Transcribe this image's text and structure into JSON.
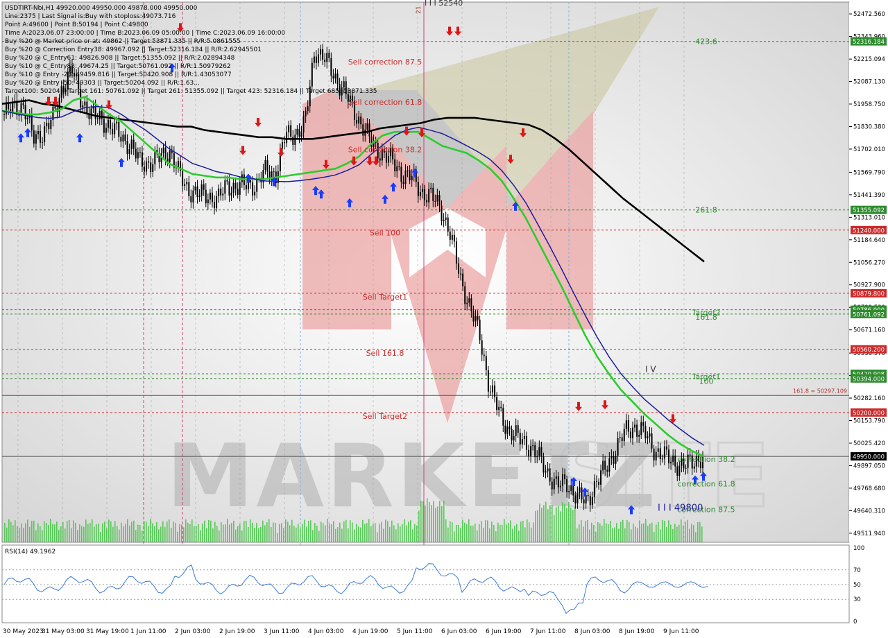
{
  "header": {
    "lines": [
      "USDTIRT-Nbi,H1  49920.000 49950.000 49878.000 49950.000",
      "Line:2375 | Last Signal is:Buy with stoploss:49073.716",
      "Point A:49600 | Point B:50194 | Point C:49800",
      "Time A:2023.06.07 23:00:00 | Time B:2023.06.09 05:00:00 | Time C:2023.06.09 16:00:00",
      "Buy %20 @ Market price or at: 49862 || Target:53871.335 || R/R:5.0861555",
      "Buy %20 @ Correction Entry38: 49967.092 || Target:52316.184 || R/R:2.62945501",
      "Buy %20 @ C_Entry61: 49826.908 || Target:51355.092 || R/R:2.02894348",
      "Buy %10 @ C_Entry88: 49674.25 || Target:50761.092 || R/R:1.50979262",
      "Buy %10 @ Entry -23: 49459.816 || Target:50420.908 || R/R:1.43053077",
      "Buy %20 @ Entry -50: 49303 || Target:50204.092 || R/R:1.63...",
      "Target100: 50204 || Target 161: 50761.092 || Target 261: 51355.092 || Target 423: 52316.184 || Target 685: 53871.335"
    ]
  },
  "price_axis": {
    "ticks": [
      "52472.560",
      "52343.960",
      "52215.094",
      "52087.130",
      "51958.750",
      "51830.380",
      "51702.010",
      "51569.790",
      "51441.390",
      "51313.010",
      "51184.640",
      "51056.270",
      "50927.900",
      "50799.530",
      "50671.160",
      "50538.970",
      "50410.390",
      "50282.160",
      "50153.790",
      "50025.420",
      "49897.050",
      "49768.680",
      "49640.310",
      "49511.940"
    ]
  },
  "price_tags": [
    {
      "text": "52316.184",
      "price": 52316.184,
      "bg": "#2e8b2e"
    },
    {
      "text": "51355.092",
      "price": 51355.092,
      "bg": "#2e8b2e"
    },
    {
      "text": "51240.000",
      "price": 51240.0,
      "bg": "#cc2a2a"
    },
    {
      "text": "50879.800",
      "price": 50879.8,
      "bg": "#cc2a2a"
    },
    {
      "text": "50786.000",
      "price": 50786.0,
      "bg": "#2e8b2e"
    },
    {
      "text": "50761.092",
      "price": 50761.092,
      "bg": "#2e8b2e"
    },
    {
      "text": "50560.200",
      "price": 50560.2,
      "bg": "#cc2a2a"
    },
    {
      "text": "50420.908",
      "price": 50420.908,
      "bg": "#2e8b2e"
    },
    {
      "text": "50394.000",
      "price": 50394.0,
      "bg": "#2e8b2e"
    },
    {
      "text": "50200.000",
      "price": 50200.0,
      "bg": "#cc2a2a"
    },
    {
      "text": "49950.000",
      "price": 49950.0,
      "bg": "#000000"
    }
  ],
  "level_lines": [
    {
      "price": 52316.184,
      "color": "#2e8b2e"
    },
    {
      "price": 51355.092,
      "color": "#2e8b2e"
    },
    {
      "price": 51240.0,
      "color": "#cc2a2a"
    },
    {
      "price": 50879.8,
      "color": "#cc2a2a"
    },
    {
      "price": 50786.0,
      "color": "#2e8b2e"
    },
    {
      "price": 50761.092,
      "color": "#2e8b2e"
    },
    {
      "price": 50560.2,
      "color": "#cc2a2a"
    },
    {
      "price": 50420.908,
      "color": "#2e8b2e"
    },
    {
      "price": 50394.0,
      "color": "#2e8b2e"
    },
    {
      "price": 50200.0,
      "color": "#cc2a2a"
    }
  ],
  "level_labels": [
    {
      "text": "423.6",
      "price": 52316.184,
      "color": "#2e8b2e",
      "at": "right"
    },
    {
      "text": "261.8",
      "price": 51355.092,
      "color": "#2e8b2e",
      "at": "right"
    },
    {
      "text": "Sell correction 87.5",
      "price": 52200,
      "color": "#cc2a2a",
      "at": "left"
    },
    {
      "text": "Sell correction 61.8",
      "price": 51970,
      "color": "#cc2a2a",
      "at": "left"
    },
    {
      "text": "Sell correction 38.2",
      "price": 51700,
      "color": "#cc2a2a",
      "at": "left"
    },
    {
      "text": "Sell 100",
      "price": 51225,
      "color": "#cc2a2a",
      "at": "left"
    },
    {
      "text": "Sell Target1",
      "price": 50860,
      "color": "#cc2a2a",
      "at": "left"
    },
    {
      "text": "Sell 161.8",
      "price": 50540,
      "color": "#cc2a2a",
      "at": "left"
    },
    {
      "text": "Sell Target2",
      "price": 50180,
      "color": "#cc2a2a",
      "at": "left"
    },
    {
      "text": "Target2",
      "price": 50770,
      "color": "#2e8b2e",
      "at": "right"
    },
    {
      "text": "161.8",
      "price": 50745,
      "color": "#2e8b2e",
      "at": "right"
    },
    {
      "text": "Target1",
      "price": 50405,
      "color": "#2e8b2e",
      "at": "right"
    },
    {
      "text": "100",
      "price": 50380,
      "color": "#2e8b2e",
      "at": "right"
    },
    {
      "text": "correction 38.2",
      "price": 49935,
      "color": "#2e8b2e",
      "at": "right"
    },
    {
      "text": "correction 61.8",
      "price": 49795,
      "color": "#2e8b2e",
      "at": "right"
    },
    {
      "text": "correction 87.5",
      "price": 49647,
      "color": "#2e8b2e",
      "at": "right"
    }
  ],
  "other_labels": {
    "fib_line": "161.8 = 50297.109",
    "wave_iv": "I V",
    "wave_iii": "I I I 49800",
    "top_mark": "I I I 52540",
    "vline_21": "21"
  },
  "rsi": {
    "label": "RSI(14) 49.1962",
    "ticks": [
      "100",
      "70",
      "50",
      "30",
      "0"
    ]
  },
  "time_axis": {
    "labels": [
      "30 May 2023",
      "31 May 03:00",
      "31 May 19:00",
      "1 Jun 11:00",
      "2 Jun 03:00",
      "2 Jun 19:00",
      "3 Jun 11:00",
      "4 Jun 03:00",
      "4 Jun 19:00",
      "5 Jun 11:00",
      "6 Jun 03:00",
      "6 Jun 19:00",
      "7 Jun 11:00",
      "8 Jun 03:00",
      "8 Jun 19:00",
      "9 Jun 11:00"
    ]
  },
  "watermark": "MARKETZ",
  "chart_data": {
    "type": "line",
    "title": "USDTIRT-Nbi,H1",
    "x": [
      "30 May 2023",
      "31 May 03:00",
      "31 May 19:00",
      "1 Jun 11:00",
      "2 Jun 03:00",
      "2 Jun 19:00",
      "3 Jun 11:00",
      "4 Jun 03:00",
      "4 Jun 19:00",
      "5 Jun 11:00",
      "6 Jun 03:00",
      "6 Jun 19:00",
      "7 Jun 11:00",
      "8 Jun 03:00",
      "8 Jun 19:00",
      "9 Jun 11:00"
    ],
    "ylim": [
      49460,
      52540
    ],
    "series": [
      {
        "values": [
          51900,
          51940,
          51950,
          51760,
          51800,
          51870,
          52060,
          52150,
          51980,
          51890,
          51880,
          51820,
          51780,
          51720,
          51630,
          51620,
          51650,
          51700,
          51560,
          51470,
          51440,
          51440,
          51410,
          51500,
          51480,
          51500,
          51500,
          51580,
          51560,
          51780,
          51790,
          51840,
          52270,
          52220,
          52120,
          52040,
          51920,
          51830,
          51720,
          51680,
          51630,
          51560,
          51540,
          51460,
          51430,
          51370,
          51210,
          50970,
          50800,
          50640,
          50350,
          50200,
          50100,
          50050,
          50020,
          49950,
          49860,
          49780,
          49800,
          49720,
          49690,
          49800,
          49880,
          49990,
          50090,
          50120,
          50080,
          49990,
          49950,
          49920,
          49890,
          49920,
          49950
        ]
      },
      {
        "values": [
          51960,
          51970,
          51980,
          51960,
          51950,
          51930,
          51910,
          51890,
          51880,
          51870,
          51860,
          51850,
          51840,
          51830,
          51830,
          51810,
          51800,
          51790,
          51780,
          51770,
          51770,
          51760,
          51760,
          51760,
          51770,
          51780,
          51790,
          51800,
          51820,
          51830,
          51840,
          51850,
          51870,
          51880,
          51880,
          51880,
          51870,
          51860,
          51850,
          51840,
          51810,
          51760,
          51700,
          51630,
          51560,
          51490,
          51420,
          51360,
          51300,
          51240,
          51180,
          51120,
          51060
        ]
      },
      {
        "values": [
          51920,
          51910,
          51900,
          51900,
          51910,
          51930,
          51980,
          52000,
          51950,
          51900,
          51860,
          51800,
          51740,
          51680,
          51620,
          51590,
          51560,
          51550,
          51540,
          51540,
          51530,
          51530,
          51530,
          51540,
          51550,
          51560,
          51570,
          51580,
          51590,
          51620,
          51660,
          51730,
          51780,
          51800,
          51800,
          51800,
          51760,
          51720,
          51700,
          51680,
          51640,
          51590,
          51520,
          51420,
          51310,
          51180,
          51050,
          50920,
          50780,
          50640,
          50520,
          50420,
          50330,
          50260,
          50190,
          50130,
          50070,
          50020,
          49980,
          49950
        ]
      }
    ]
  }
}
